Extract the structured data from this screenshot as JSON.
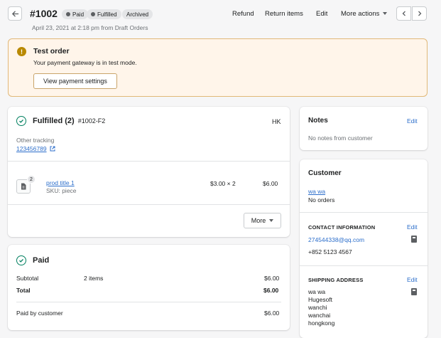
{
  "header": {
    "order_number": "#1002",
    "badges": {
      "paid": "Paid",
      "fulfilled": "Fulfilled",
      "archived": "Archived"
    },
    "subtitle": "April 23, 2021 at 2:18 pm from Draft Orders",
    "actions": {
      "refund": "Refund",
      "return_items": "Return items",
      "edit": "Edit",
      "more_actions": "More actions"
    }
  },
  "banner": {
    "title": "Test order",
    "text": "Your payment gateway is in test mode.",
    "button": "View payment settings"
  },
  "fulfilled": {
    "title": "Fulfilled (2)",
    "code": "#1002-F2",
    "location": "HK",
    "tracking_label": "Other tracking",
    "tracking_number": "123456789",
    "item": {
      "quantity_badge": "2",
      "name": "prod title 1",
      "sku": "SKU: piece",
      "price_qty": "$3.00 × 2",
      "total": "$6.00"
    },
    "more_button": "More"
  },
  "paid": {
    "title": "Paid",
    "rows": {
      "subtotal_label": "Subtotal",
      "subtotal_items": "2 items",
      "subtotal_value": "$6.00",
      "total_label": "Total",
      "total_value": "$6.00",
      "paid_label": "Paid by customer",
      "paid_value": "$6.00"
    }
  },
  "notes": {
    "title": "Notes",
    "edit": "Edit",
    "text": "No notes from customer"
  },
  "customer": {
    "title": "Customer",
    "name": "wa wa",
    "orders": "No orders",
    "contact_head": "CONTACT INFORMATION",
    "contact_edit": "Edit",
    "email": "274544338@qq.com",
    "phone": "+852 5123 4567",
    "shipping_head": "SHIPPING ADDRESS",
    "shipping_edit": "Edit",
    "address": [
      "wa wa",
      "Hugesoft",
      "wanchi",
      "wanchai",
      "hongkong"
    ]
  },
  "colors": {
    "accent": "#2c6ecb",
    "success": "#007f5f",
    "warning_bg": "#fff5ea",
    "warning_border": "#e1b878"
  }
}
